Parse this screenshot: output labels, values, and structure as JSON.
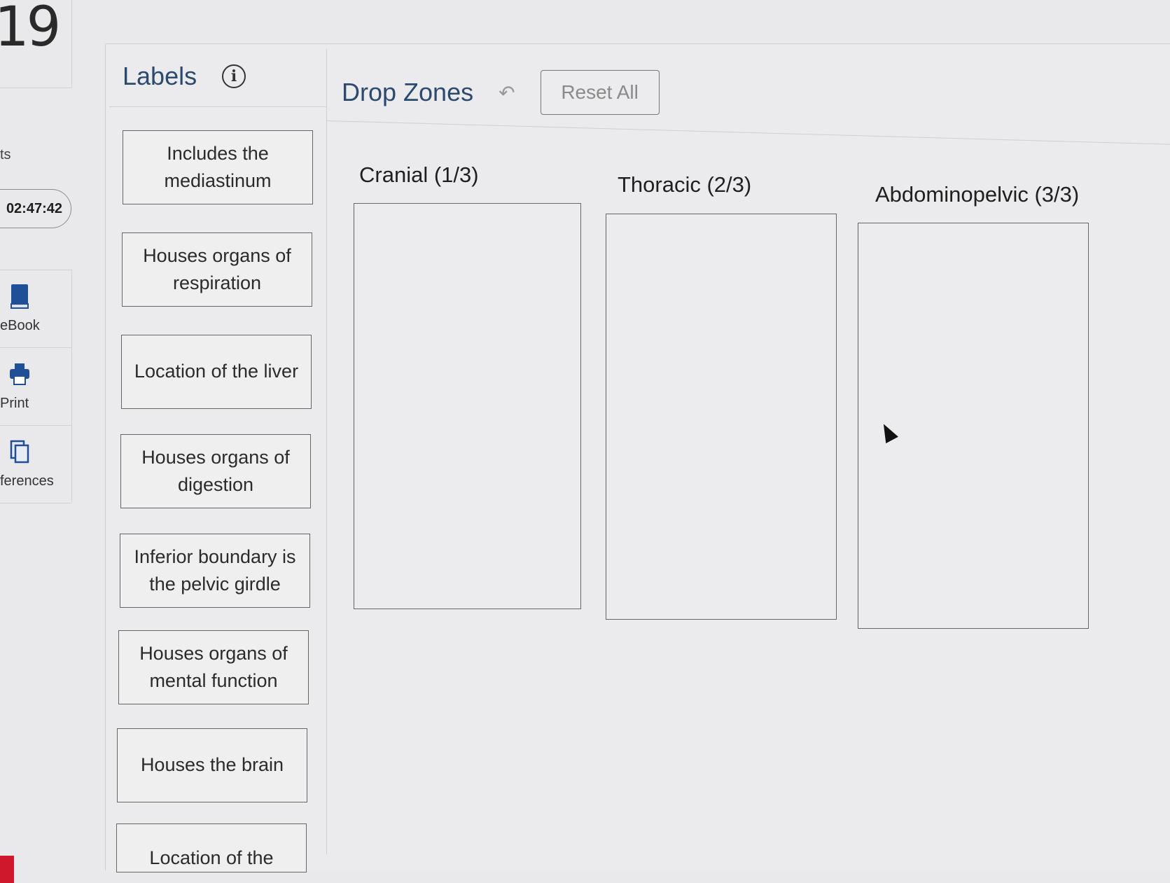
{
  "question_number": "19",
  "sidebar": {
    "fragment": "ts",
    "timer": "02:47:42",
    "tools": [
      {
        "label": "eBook",
        "icon": "book-icon"
      },
      {
        "label": "Print",
        "icon": "printer-icon"
      },
      {
        "label": "ferences",
        "icon": "references-icon"
      }
    ]
  },
  "labels_panel": {
    "title": "Labels",
    "items": [
      "Includes the mediastinum",
      "Houses organs of respiration",
      "Location of the liver",
      "Houses organs of digestion",
      "Inferior boundary is the pelvic girdle",
      "Houses organs of mental function",
      "Houses the brain",
      "Location of the"
    ]
  },
  "drop_zones_panel": {
    "title": "Drop Zones",
    "reset_label": "Reset All",
    "zones": [
      {
        "title": "Cranial (1/3)"
      },
      {
        "title": "Thoracic (2/3)"
      },
      {
        "title": "Abdominopelvic (3/3)"
      }
    ]
  }
}
